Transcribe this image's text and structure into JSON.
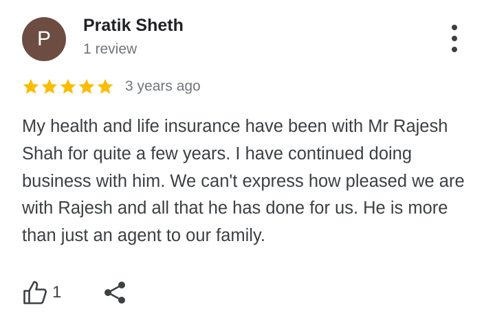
{
  "review": {
    "author": {
      "avatar_letter": "P",
      "avatar_color": "#6d4c41",
      "name": "Pratik Sheth",
      "review_count": "1 review"
    },
    "menu_icon": "more-vert-icon",
    "rating": {
      "stars": 5,
      "max_stars": 5,
      "star_color": "#fbbc04"
    },
    "date": "3 years ago",
    "text": "My health and life insurance have been with Mr Rajesh Shah for quite a few years. I have continued doing business with him. We can't express how pleased we are with Rajesh and all that he has done for us. He is more than just an agent to our family.",
    "actions": {
      "like_icon": "thumb-up-icon",
      "like_count": "1",
      "share_icon": "share-icon"
    }
  }
}
